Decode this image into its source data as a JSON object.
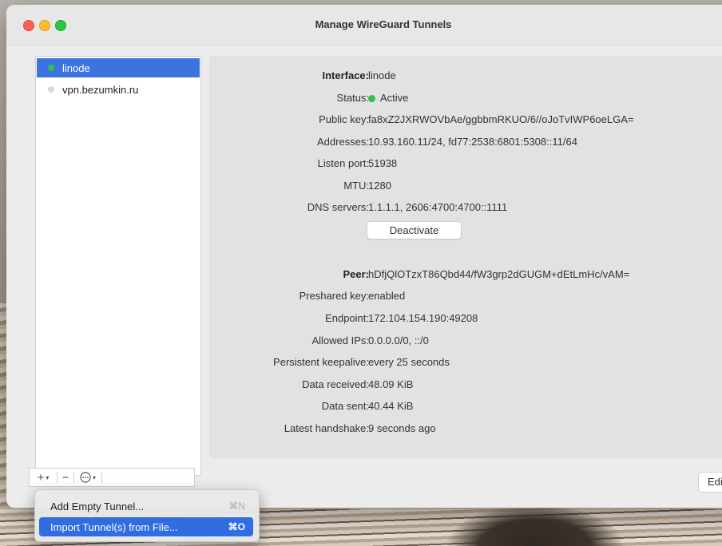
{
  "window": {
    "title": "Manage WireGuard Tunnels"
  },
  "sidebar": {
    "tunnels": [
      {
        "name": "linode",
        "selected": true,
        "status_color": "#2fc24a"
      },
      {
        "name": "vpn.bezumkin.ru",
        "selected": false,
        "status_color": "#d9d9d9"
      }
    ],
    "toolbar": {
      "add_icon": "plus-icon",
      "remove_icon": "minus-icon",
      "more_icon": "ellipsis-circle-icon"
    }
  },
  "interface": {
    "label": "Interface:",
    "name": "linode",
    "status_label": "Status:",
    "status_value": "Active",
    "public_key_label": "Public key:",
    "public_key": "fa8xZ2JXRWOVbAe/ggbbmRKUO/6//oJoTvIWP6oeLGA=",
    "addresses_label": "Addresses:",
    "addresses": "10.93.160.11/24, fd77:2538:6801:5308::11/64",
    "listen_port_label": "Listen port:",
    "listen_port": "51938",
    "mtu_label": "MTU:",
    "mtu": "1280",
    "dns_label": "DNS servers:",
    "dns": "1.1.1.1, 2606:4700:4700::1111",
    "deactivate_label": "Deactivate"
  },
  "peer": {
    "label": "Peer:",
    "public_key": "hDfjQlOTzxT86Qbd44/fW3grp2dGUGM+dEtLmHc/vAM=",
    "preshared_label": "Preshared key:",
    "preshared": "enabled",
    "endpoint_label": "Endpoint:",
    "endpoint": "172.104.154.190:49208",
    "allowed_label": "Allowed IPs:",
    "allowed": "0.0.0.0/0, ::/0",
    "keepalive_label": "Persistent keepalive:",
    "keepalive": "every 25 seconds",
    "received_label": "Data received:",
    "received": "48.09 KiB",
    "sent_label": "Data sent:",
    "sent": "40.44 KiB",
    "handshake_label": "Latest handshake:",
    "handshake": "9 seconds ago"
  },
  "edit_label": "Edit",
  "menu": {
    "items": [
      {
        "label": "Add Empty Tunnel...",
        "shortcut": "⌘N",
        "highlighted": false
      },
      {
        "label": "Import Tunnel(s) from File...",
        "shortcut": "⌘O",
        "highlighted": true
      }
    ]
  },
  "colors": {
    "accent": "#3b73df",
    "active_green": "#2fc24a"
  }
}
